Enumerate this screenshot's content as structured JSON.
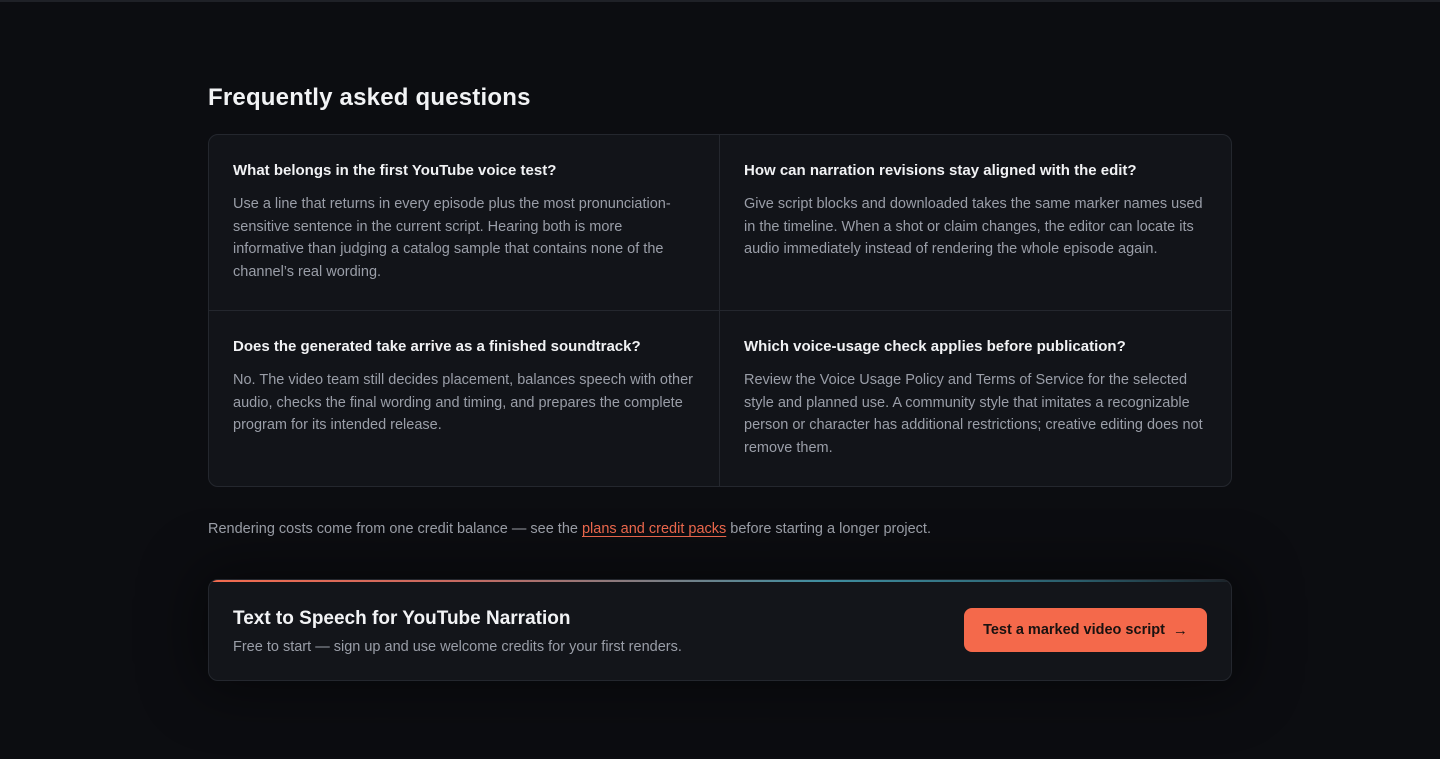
{
  "faq": {
    "title": "Frequently asked questions",
    "items": [
      {
        "question": "What belongs in the first YouTube voice test?",
        "answer": "Use a line that returns in every episode plus the most pronunciation-sensitive sentence in the current script. Hearing both is more informative than judging a catalog sample that contains none of the channel’s real wording."
      },
      {
        "question": "How can narration revisions stay aligned with the edit?",
        "answer": "Give script blocks and downloaded takes the same marker names used in the timeline. When a shot or claim changes, the editor can locate its audio immediately instead of rendering the whole episode again."
      },
      {
        "question": "Does the generated take arrive as a finished soundtrack?",
        "answer": "No. The video team still decides placement, balances speech with other audio, checks the final wording and timing, and prepares the complete program for its intended release."
      },
      {
        "question": "Which voice-usage check applies before publication?",
        "answer": "Review the Voice Usage Policy and Terms of Service for the selected style and planned use. A community style that imitates a recognizable person or character has additional restrictions; creative editing does not remove them."
      }
    ]
  },
  "credits_note": {
    "before": "Rendering costs come from one credit balance — see the ",
    "link": "plans and credit packs",
    "after": " before starting a longer project."
  },
  "cta": {
    "title": "Text to Speech for YouTube Narration",
    "subtitle": "Free to start — sign up and use welcome credits for your first renders.",
    "button_label": "Test a marked video script",
    "button_icon": "arrow-right-icon",
    "arrow_glyph": "→"
  },
  "colors": {
    "background": "#0c0d11",
    "card": "#121419",
    "accent": "#f4694b",
    "link": "#f36b4f",
    "muted_text": "#9a9ea8"
  }
}
